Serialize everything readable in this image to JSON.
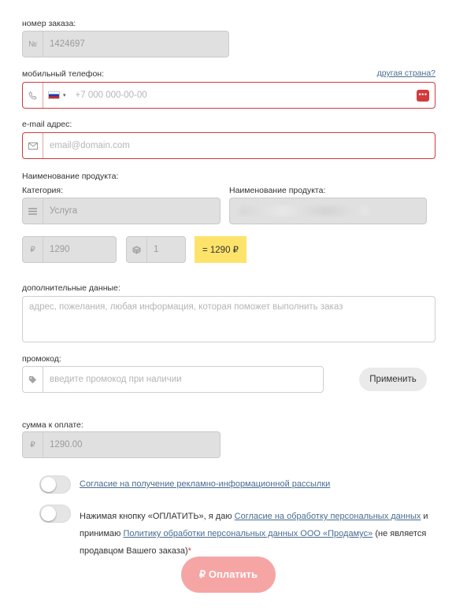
{
  "order": {
    "label": "номер заказа:",
    "icon": "number-icon",
    "value": "1424697"
  },
  "phone": {
    "label": "мобильный телефон:",
    "other_country_link": "другая страна?",
    "placeholder": "+7 000 000-00-00",
    "icon": "phone-icon",
    "flag": "russia-flag-icon",
    "error_color": "#d33a3a"
  },
  "email": {
    "label": "e-mail адрес:",
    "placeholder": "email@domain.com",
    "icon": "envelope-icon"
  },
  "product": {
    "section_label": "Наименование продукта:",
    "category_label": "Категория:",
    "category_value": "Услуга",
    "name_label": "Наименование продукта:"
  },
  "price": {
    "value": "1290",
    "quantity": "1",
    "total": "= 1290 ₽",
    "total_bg": "#fde36a"
  },
  "additional": {
    "label": "дополнительные данные:",
    "placeholder": "адрес, пожелания, любая информация, которая поможет выполнить заказ"
  },
  "promo": {
    "label": "промокод:",
    "placeholder": "введите промокод при наличии",
    "apply_button": "Применить"
  },
  "sum": {
    "label": "сумма к оплате:",
    "value": "1290.00"
  },
  "consent": {
    "newsletter_link": "Согласие на получение рекламно-информационной рассылки",
    "terms_text_1": "Нажимая кнопку «ОПЛАТИТЬ», я даю",
    "terms_link_1": "Согласие на обработку персональных данных",
    "terms_text_2": "и принимаю",
    "terms_link_2": "Политику обработки персональных данных ООО «Продамус»",
    "terms_text_3": "(не является продавцом Вашего заказа)",
    "required_mark": "*"
  },
  "pay_button": {
    "label": "₽ Оплатить",
    "color": "#f6a5a5"
  }
}
